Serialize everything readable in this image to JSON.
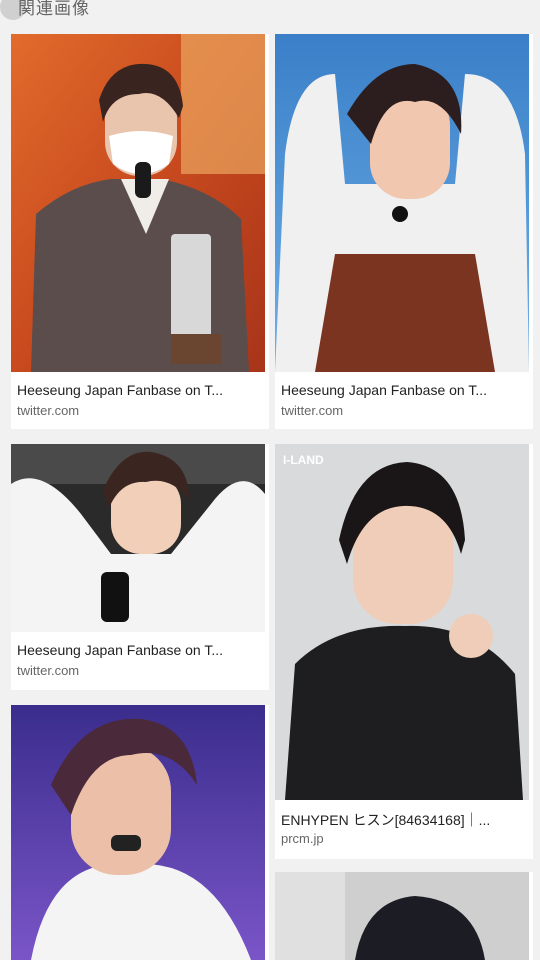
{
  "header": {
    "title": "関連画像"
  },
  "results": [
    {
      "title": "Heeseung Japan Fanbase on T...",
      "source": "twitter.com"
    },
    {
      "title": "Heeseung Japan Fanbase on T...",
      "source": "twitter.com"
    },
    {
      "title": "Heeseung Japan Fanbase on T...",
      "source": "twitter.com"
    },
    {
      "title": "ENHYPEN ヒスン[84634168]｜...",
      "source": "prcm.jp"
    },
    {
      "title": "",
      "source": ""
    },
    {
      "title": "",
      "source": ""
    }
  ],
  "overlays": {
    "iland_label": "I-LAND"
  }
}
